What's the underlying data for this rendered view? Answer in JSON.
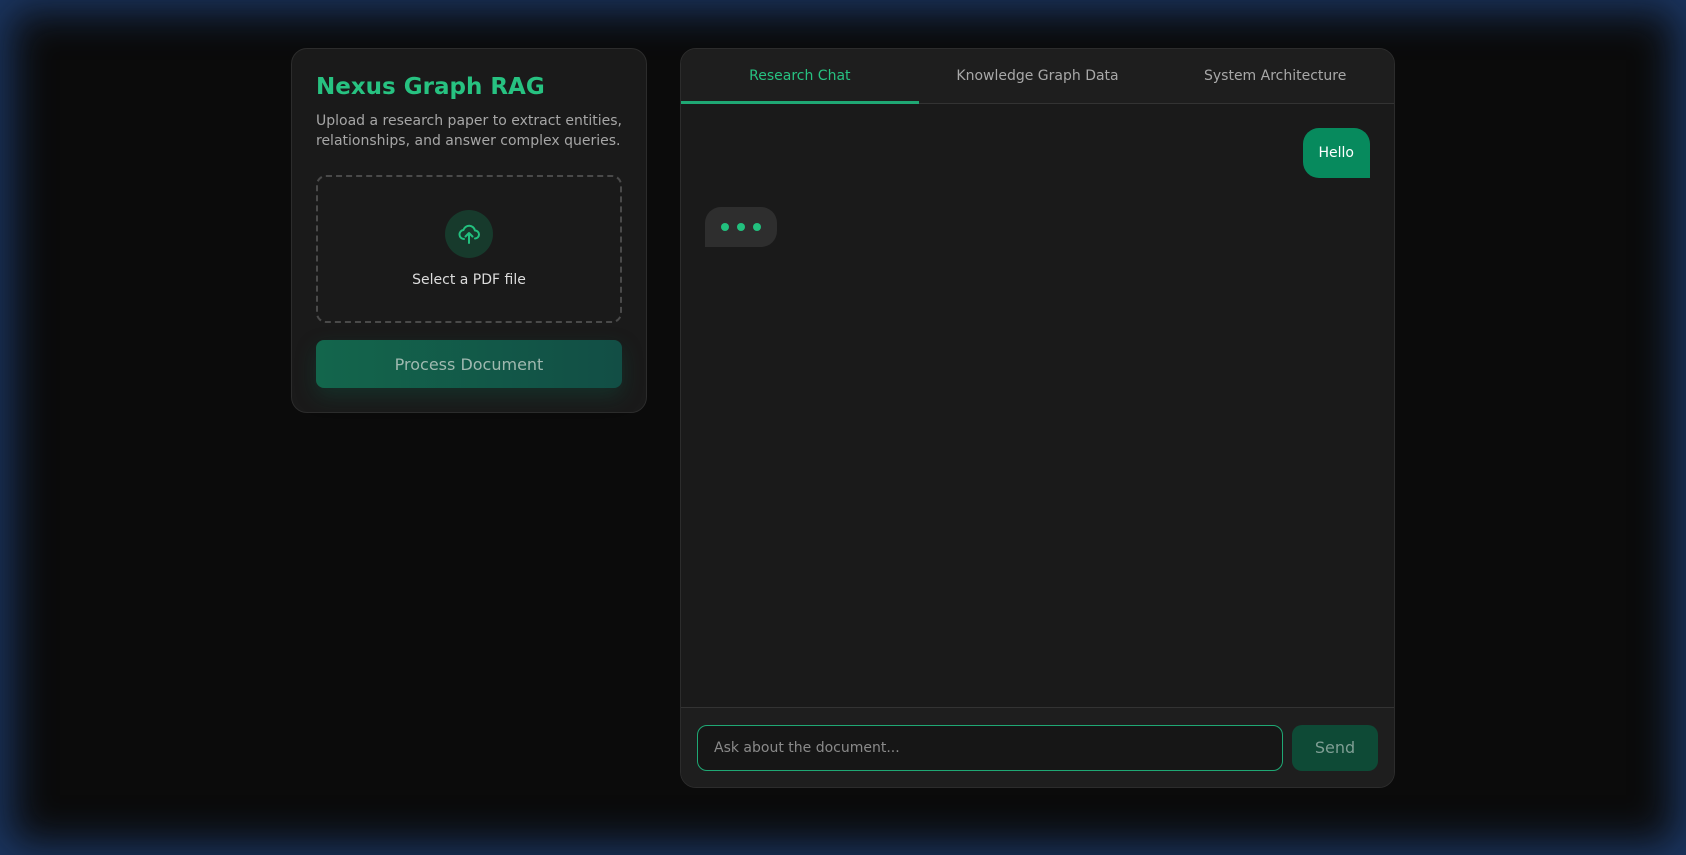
{
  "sidebar": {
    "title": "Nexus Graph RAG",
    "description": "Upload a research paper to extract entities, relationships, and answer complex queries.",
    "upload": {
      "icon": "cloud-upload-icon",
      "label": "Select a PDF file"
    },
    "process_button": "Process Document"
  },
  "tabs": [
    {
      "label": "Research Chat",
      "active": true
    },
    {
      "label": "Knowledge Graph Data",
      "active": false
    },
    {
      "label": "System Architecture",
      "active": false
    }
  ],
  "chat": {
    "messages": [
      {
        "role": "user",
        "text": "Hello"
      }
    ],
    "typing_indicator": true,
    "input_placeholder": "Ask about the document...",
    "input_value": "",
    "send_label": "Send"
  },
  "colors": {
    "accent": "#27c281",
    "user_bubble": "#078a5d",
    "panel_bg": "#1a1a1a",
    "page_bg": "#0b0b0b"
  }
}
